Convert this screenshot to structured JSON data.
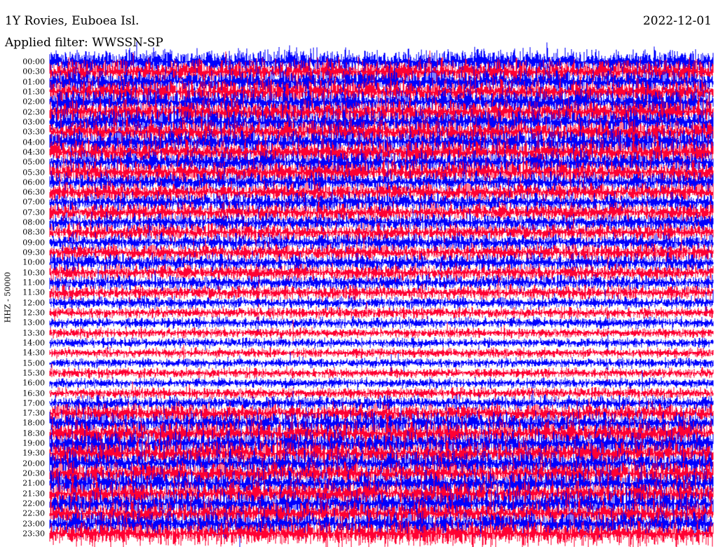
{
  "header": {
    "title": "1Y Rovies, Euboea Isl.",
    "date": "2022-12-01",
    "filter": "Applied filter: WWSSN-SP"
  },
  "chart_data": {
    "type": "line",
    "subtype": "helicorder",
    "title": "1Y Rovies, Euboea Isl.",
    "ylabel": "HHZ - 50000",
    "xlabel": "",
    "row_labels": [
      "00:00",
      "00:30",
      "01:00",
      "01:30",
      "02:00",
      "02:30",
      "03:00",
      "03:30",
      "04:00",
      "04:30",
      "05:00",
      "05:30",
      "06:00",
      "06:30",
      "07:00",
      "07:30",
      "08:00",
      "08:30",
      "09:00",
      "09:30",
      "10:00",
      "10:30",
      "11:00",
      "11:30",
      "12:00",
      "12:30",
      "13:00",
      "13:30",
      "14:00",
      "14:30",
      "15:00",
      "15:30",
      "16:00",
      "16:30",
      "17:00",
      "17:30",
      "18:00",
      "18:30",
      "19:00",
      "19:30",
      "20:00",
      "20:30",
      "21:00",
      "21:30",
      "22:00",
      "22:30",
      "23:00",
      "23:30"
    ],
    "relative_amplitude": [
      1.0,
      1.0,
      1.0,
      1.0,
      1.0,
      1.0,
      1.0,
      1.0,
      1.0,
      1.0,
      0.9,
      0.9,
      0.8,
      0.8,
      0.75,
      0.75,
      0.7,
      0.7,
      0.7,
      0.7,
      0.7,
      0.65,
      0.6,
      0.6,
      0.5,
      0.45,
      0.45,
      0.4,
      0.4,
      0.4,
      0.4,
      0.4,
      0.4,
      0.45,
      0.6,
      0.8,
      0.9,
      1.0,
      1.0,
      1.0,
      1.0,
      1.0,
      1.0,
      1.0,
      1.0,
      1.0,
      1.0,
      1.0
    ],
    "series_colors": [
      "#0000ff",
      "#ff0033"
    ]
  }
}
